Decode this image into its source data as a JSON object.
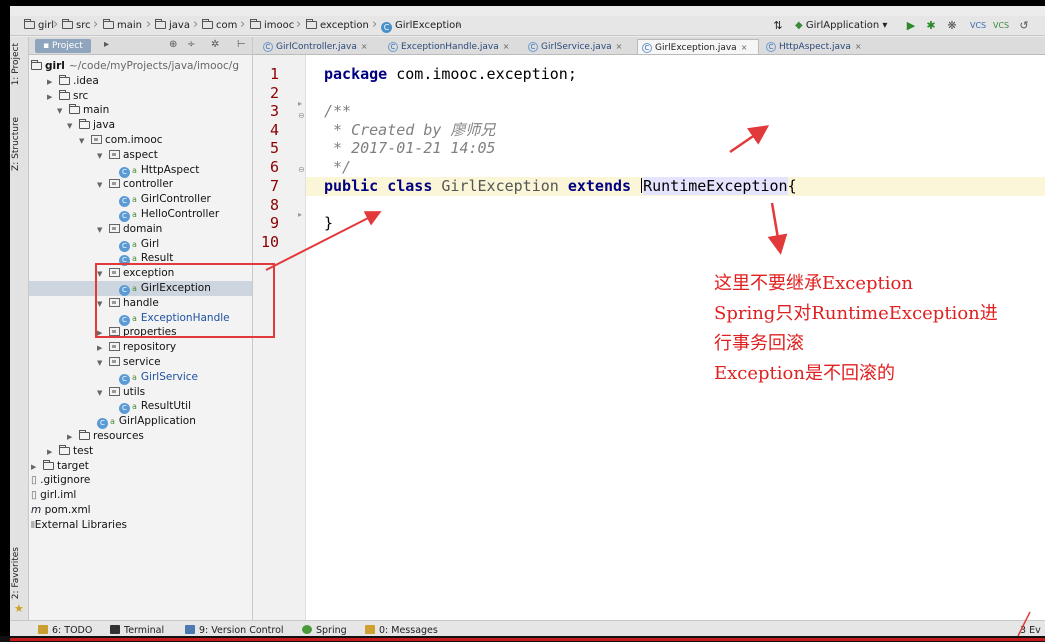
{
  "breadcrumbs": [
    "girl",
    "src",
    "main",
    "java",
    "com",
    "imooc",
    "exception",
    "GirlException"
  ],
  "run_config": "GirlApplication",
  "project_panel": {
    "tab_label": "Project",
    "root_path": "~/code/myProjects/java/imooc/g"
  },
  "left_strip": {
    "project": "1: Project",
    "structure": "Z: Structure",
    "favorites": "2: Favorites"
  },
  "tree": [
    {
      "label": "girl",
      "depth": 0,
      "kind": "root"
    },
    {
      "label": ".idea",
      "depth": 1,
      "kind": "dir"
    },
    {
      "label": "src",
      "depth": 1,
      "kind": "dir"
    },
    {
      "label": "main",
      "depth": 2,
      "kind": "dir",
      "open": true
    },
    {
      "label": "java",
      "depth": 3,
      "kind": "dir",
      "open": true
    },
    {
      "label": "com.imooc",
      "depth": 4,
      "kind": "pkg",
      "open": true
    },
    {
      "label": "aspect",
      "depth": 5,
      "kind": "pkg",
      "open": true
    },
    {
      "label": "HttpAspect",
      "depth": 6,
      "kind": "class"
    },
    {
      "label": "controller",
      "depth": 5,
      "kind": "pkg",
      "open": true
    },
    {
      "label": "GirlController",
      "depth": 6,
      "kind": "class"
    },
    {
      "label": "HelloController",
      "depth": 6,
      "kind": "class"
    },
    {
      "label": "domain",
      "depth": 5,
      "kind": "pkg",
      "open": true
    },
    {
      "label": "Girl",
      "depth": 6,
      "kind": "class"
    },
    {
      "label": "Result",
      "depth": 6,
      "kind": "class"
    },
    {
      "label": "exception",
      "depth": 5,
      "kind": "pkg",
      "open": true
    },
    {
      "label": "GirlException",
      "depth": 6,
      "kind": "class",
      "selected": true
    },
    {
      "label": "handle",
      "depth": 5,
      "kind": "pkg",
      "open": true
    },
    {
      "label": "ExceptionHandle",
      "depth": 6,
      "kind": "class",
      "blue": true
    },
    {
      "label": "properties",
      "depth": 5,
      "kind": "pkg"
    },
    {
      "label": "repository",
      "depth": 5,
      "kind": "pkg"
    },
    {
      "label": "service",
      "depth": 5,
      "kind": "pkg",
      "open": true
    },
    {
      "label": "GirlService",
      "depth": 6,
      "kind": "class",
      "blue": true
    },
    {
      "label": "utils",
      "depth": 5,
      "kind": "pkg",
      "open": true
    },
    {
      "label": "ResultUtil",
      "depth": 6,
      "kind": "class"
    },
    {
      "label": "GirlApplication",
      "depth": 5,
      "kind": "app"
    },
    {
      "label": "resources",
      "depth": 3,
      "kind": "dir"
    },
    {
      "label": "test",
      "depth": 1,
      "kind": "dir"
    },
    {
      "label": "target",
      "depth": 0,
      "kind": "dir"
    },
    {
      "label": ".gitignore",
      "depth": 0,
      "kind": "file"
    },
    {
      "label": "girl.iml",
      "depth": 0,
      "kind": "file"
    },
    {
      "label": "pom.xml",
      "depth": 0,
      "kind": "maven"
    },
    {
      "label": "External Libraries",
      "depth": 0,
      "kind": "lib"
    }
  ],
  "tabs": [
    {
      "label": "GirlController.java"
    },
    {
      "label": "ExceptionHandle.java"
    },
    {
      "label": "GirlService.java"
    },
    {
      "label": "GirlException.java",
      "active": true
    },
    {
      "label": "HttpAspect.java"
    }
  ],
  "code": {
    "line_numbers": [
      "1",
      "2",
      "3",
      "4",
      "5",
      "6",
      "7",
      "8",
      "9",
      "10"
    ],
    "l1_kw": "package",
    "l1_rest": " com.imooc.exception;",
    "l3": "/**",
    "l4": " * Created by 廖师兄",
    "l5": " * 2017-01-21 14:05",
    "l6": " */",
    "l7_kw1": "public",
    "l7_kw2": "class",
    "l7_name": "GirlException",
    "l7_kw3": "extends",
    "l7_ref": "RuntimeException",
    "l7_brace": "{",
    "l9": "}"
  },
  "annotation": [
    "这里不要继承Exception",
    "Spring只对RuntimeException进",
    "行事务回滚",
    "Exception是不回滚的"
  ],
  "status_bar": {
    "todo": "6: TODO",
    "terminal": "Terminal",
    "vcs": "9: Version Control",
    "spring": "Spring",
    "messages": "0: Messages",
    "event": "3 Ev"
  },
  "colors": {
    "annotation": "#e02020",
    "keyword": "#000080",
    "selection": "#cdd5de"
  }
}
